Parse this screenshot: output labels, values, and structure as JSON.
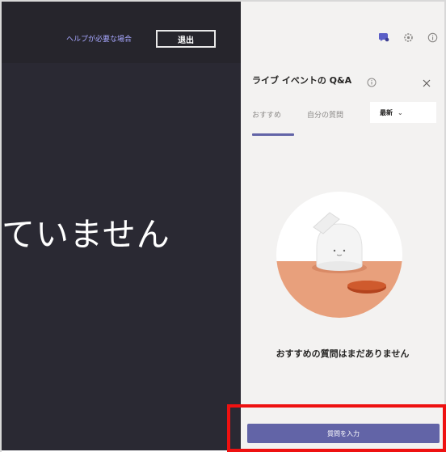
{
  "left": {
    "help_link": "ヘルプが必要な場合",
    "exit_button": "退出",
    "status_text": "ていません"
  },
  "panel": {
    "icons": [
      "chat-icon",
      "gear-icon",
      "info-icon"
    ],
    "title": "ライブ イベントの Q&A",
    "tabs": [
      {
        "label": "おすすめ",
        "active": true
      },
      {
        "label": "自分の質問",
        "active": false
      }
    ],
    "sort": {
      "selected": "最新"
    },
    "empty_message": "おすすめの質問はまだありません",
    "ask_button": "質問を入力"
  },
  "colors": {
    "accent": "#6264a7",
    "dark_bg": "#2a2933",
    "panel_bg": "#f3f2f1",
    "highlight": "#ee1111"
  }
}
